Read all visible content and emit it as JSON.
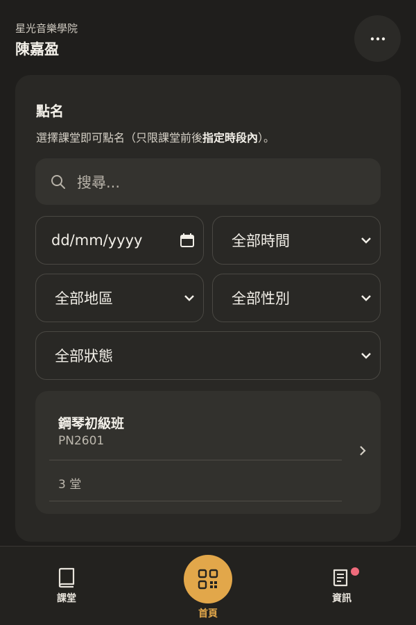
{
  "header": {
    "school": "星光音樂學院",
    "user": "陳嘉盈"
  },
  "card": {
    "title": "點名",
    "desc_prefix": "選擇課堂即可點名（只限課堂前後",
    "desc_bold": "指定時段內",
    "desc_suffix": "）。",
    "search_placeholder": "搜尋..."
  },
  "filters": {
    "date": "dd/mm/yyyy",
    "time": "全部時間",
    "region": "全部地區",
    "gender": "全部性別",
    "status": "全部狀態"
  },
  "class_item": {
    "name": "鋼琴初級班",
    "code": "PN2601",
    "count": "3 堂"
  },
  "nav": {
    "lessons": "課堂",
    "home": "首頁",
    "news": "資訊"
  },
  "colors": {
    "accent": "#e2a74a",
    "badge": "#ef6b7b"
  },
  "icons": [
    "more-icon",
    "search-icon",
    "calendar-icon",
    "chevron-down-icon",
    "chevron-right-icon",
    "book-icon",
    "qr-code-icon",
    "news-icon"
  ]
}
